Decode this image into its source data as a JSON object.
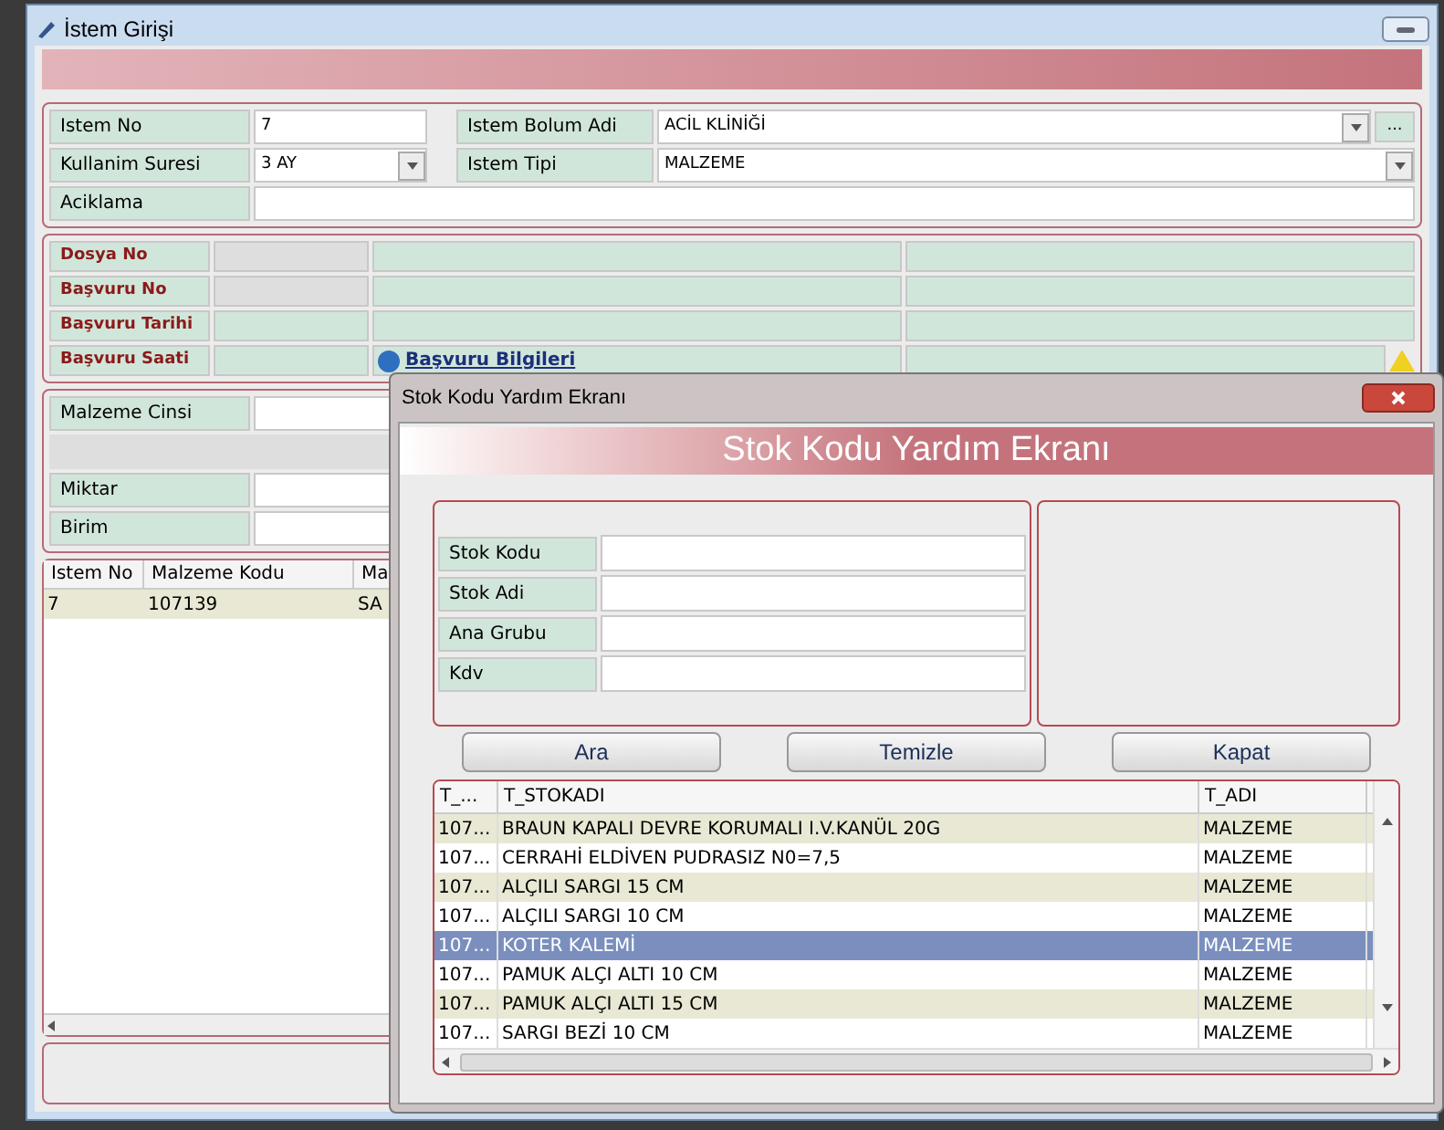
{
  "main_window": {
    "title": "İstem Girişi",
    "header_fields": {
      "istem_no": {
        "label": "Istem No",
        "value": "7"
      },
      "istem_bolum_adi": {
        "label": "Istem Bolum Adi",
        "value": "ACİL KLİNİĞİ"
      },
      "more_button": "...",
      "kullanim_suresi": {
        "label": "Kullanim Suresi",
        "value": "3 AY"
      },
      "istem_tipi": {
        "label": "Istem Tipi",
        "value": "MALZEME"
      },
      "aciklama": {
        "label": "Aciklama"
      }
    },
    "patient_fields": [
      {
        "label": "Dosya No"
      },
      {
        "label": "Başvuru No"
      },
      {
        "label": "Başvuru Tarihi"
      },
      {
        "label": "Başvuru Saati"
      }
    ],
    "info_link": "Başvuru Bilgileri",
    "material_fields": [
      {
        "label": "Malzeme Cinsi"
      },
      {
        "label": "Miktar"
      },
      {
        "label": "Birim"
      }
    ],
    "table": {
      "columns": [
        "Istem No",
        "Malzeme Kodu",
        "Ma"
      ],
      "rows": [
        [
          "7",
          "107139",
          "SA"
        ]
      ]
    }
  },
  "dialog": {
    "title": "Stok Kodu Yardım Ekranı",
    "header": "Stok Kodu Yardım Ekranı",
    "search_fields": [
      {
        "label": "Stok Kodu"
      },
      {
        "label": "Stok Adi"
      },
      {
        "label": "Ana Grubu"
      },
      {
        "label": "Kdv"
      }
    ],
    "buttons": [
      "Ara",
      "Temizle",
      "Kapat"
    ],
    "grid": {
      "columns": [
        "T_...",
        "T_STOKADI",
        "T_ADI"
      ],
      "rows": [
        {
          "cells": [
            "107...",
            "BRAUN KAPALI DEVRE KORUMALI I.V.KANÜL 20G",
            "MALZEME"
          ],
          "selected": false
        },
        {
          "cells": [
            "107...",
            "CERRAHİ ELDİVEN PUDRASIZ N0=7,5",
            "MALZEME"
          ],
          "selected": false
        },
        {
          "cells": [
            "107...",
            "ALÇILI SARGI 15 CM",
            "MALZEME"
          ],
          "selected": false
        },
        {
          "cells": [
            "107...",
            "ALÇILI SARGI 10 CM",
            "MALZEME"
          ],
          "selected": false
        },
        {
          "cells": [
            "107...",
            "KOTER KALEMİ",
            "MALZEME"
          ],
          "selected": true
        },
        {
          "cells": [
            "107...",
            "PAMUK ALÇI ALTI 10 CM",
            "MALZEME"
          ],
          "selected": false
        },
        {
          "cells": [
            "107...",
            "PAMUK ALÇI ALTI 15 CM",
            "MALZEME"
          ],
          "selected": false
        },
        {
          "cells": [
            "107...",
            "SARGI BEZİ 10 CM",
            "MALZEME"
          ],
          "selected": false
        }
      ]
    }
  }
}
